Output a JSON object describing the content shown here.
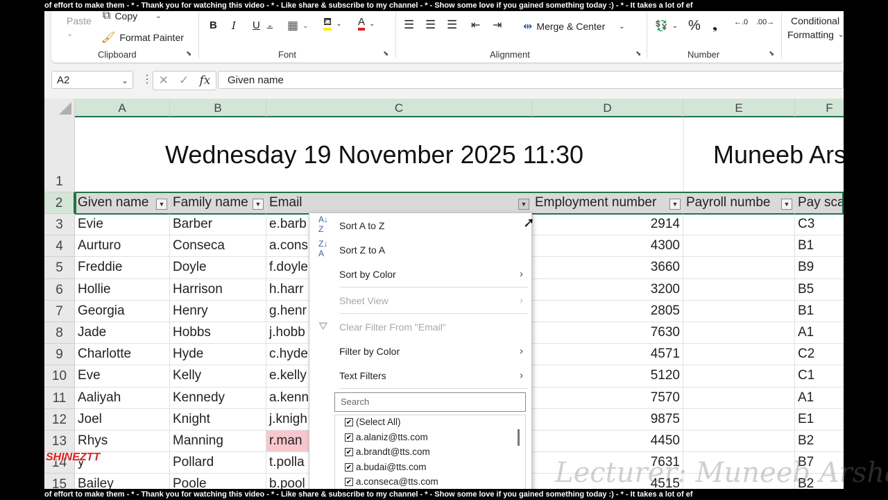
{
  "ticker_text": "of effort to make them - * - Thank you for watching this video - * - Like share & subscribe to my channel - * - Show some love if you gained something today :) - * - It takes a lot of ef",
  "ribbon": {
    "paste": "Paste",
    "copy": "Copy",
    "format_painter": "Format Painter",
    "clipboard": "Clipboard",
    "font_group": "Font",
    "alignment_group": "Alignment",
    "merge_center": "Merge & Center",
    "number_group": "Number",
    "conditional": "Conditional",
    "formatting": "Formatting"
  },
  "formula_bar": {
    "name_box": "A2",
    "formula": "Given name"
  },
  "columns": [
    "A",
    "B",
    "C",
    "D",
    "E",
    "F"
  ],
  "title_row": {
    "row_number": "1",
    "datetime": "Wednesday 19 November 2025 11:30",
    "author": "Muneeb Ars"
  },
  "header_row": {
    "row_number": "2",
    "cells": [
      "Given name",
      "Family name",
      "Email",
      "Employment number",
      "Payroll numbe",
      "Pay sca"
    ]
  },
  "rows": [
    {
      "n": "3",
      "given": "Evie",
      "family": "Barber",
      "email": "e.barb",
      "emp": "2914",
      "pay": "C3"
    },
    {
      "n": "4",
      "given": "Aurturo",
      "family": "Conseca",
      "email": "a.cons",
      "emp": "4300",
      "pay": "B1"
    },
    {
      "n": "5",
      "given": "Freddie",
      "family": "Doyle",
      "email": "f.doyle",
      "emp": "3660",
      "pay": "B9"
    },
    {
      "n": "6",
      "given": "Hollie",
      "family": "Harrison",
      "email": "h.harr",
      "emp": "3200",
      "pay": "B5"
    },
    {
      "n": "7",
      "given": "Georgia",
      "family": "Henry",
      "email": "g.henr",
      "emp": "2805",
      "pay": "B1"
    },
    {
      "n": "8",
      "given": "Jade",
      "family": "Hobbs",
      "email": "j.hobb",
      "emp": "7630",
      "pay": "A1"
    },
    {
      "n": "9",
      "given": "Charlotte",
      "family": "Hyde",
      "email": "c.hyde",
      "emp": "4571",
      "pay": "C2"
    },
    {
      "n": "10",
      "given": "Eve",
      "family": "Kelly",
      "email": "e.kelly",
      "emp": "5120",
      "pay": "C1"
    },
    {
      "n": "11",
      "given": "Aaliyah",
      "family": "Kennedy",
      "email": "a.kenn",
      "emp": "7570",
      "pay": "A1"
    },
    {
      "n": "12",
      "given": "Joel",
      "family": "Knight",
      "email": "j.knigh",
      "emp": "9875",
      "pay": "E1"
    },
    {
      "n": "13",
      "given": "Rhys",
      "family": "Manning",
      "email": "r.man",
      "emp": "4450",
      "pay": "B2"
    },
    {
      "n": "14",
      "given": "y",
      "family": "Pollard",
      "email": "t.polla",
      "emp": "7631",
      "pay": "B7"
    },
    {
      "n": "15",
      "given": "Bailey",
      "family": "Poole",
      "email": "b.pool",
      "emp": "4515",
      "pay": "B2"
    }
  ],
  "highlight_color": "#f8c7ce",
  "filter_menu": {
    "sort_az": "Sort A to Z",
    "sort_za": "Sort Z to A",
    "sort_color": "Sort by Color",
    "sheet_view": "Sheet View",
    "clear_filter": "Clear Filter From \"Email\"",
    "filter_color": "Filter by Color",
    "text_filters": "Text Filters",
    "search_placeholder": "Search",
    "list": [
      "(Select All)",
      "a.alaniz@tts.com",
      "a.brandt@tts.com",
      "a.budai@tts.com",
      "a.conseca@tts.com"
    ]
  },
  "logo_text": "SHINEZTT",
  "watermark": "Lecturer: Muneeb Arshad"
}
